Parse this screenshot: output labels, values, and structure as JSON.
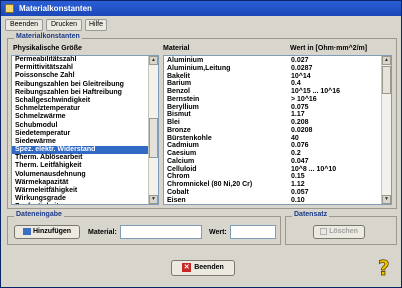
{
  "window": {
    "title": "Materialkonstanten"
  },
  "menu": {
    "items": [
      "Beenden",
      "Drucken",
      "Hilfe"
    ]
  },
  "main_group": {
    "title": "Materialkonstanten"
  },
  "left_list": {
    "header": "Physikalische Größe",
    "selected_index": 14,
    "items": [
      "Permeabilitätszahl",
      "Permittivitätszahl",
      "Poissonsche Zahl",
      "Reibungszahlen bei Gleitreibung",
      "Reibungszahlen bei Haftreibung",
      "Schallgeschwindigkeit",
      "Schmelztemperatur",
      "Schmelzwärme",
      "Schubmodul",
      "Siedetemperatur",
      "Siedewärme",
      "Spez. elektr. Widerstand",
      "Therm. Ablösearbeit",
      "Therm. Leitfähigkeit",
      "Volumenausdehnung",
      "Wärmekapazität",
      "Wärmeleitfähigkeit",
      "Wirkungsgrade",
      "Zugfestigkeit"
    ]
  },
  "right_table": {
    "header_material": "Material",
    "header_value": "Wert in [Ohm·mm^2/m]",
    "rows": [
      [
        "Aluminium",
        "0.027"
      ],
      [
        "Aluminium,Leitung",
        "0.0287"
      ],
      [
        "Bakelit",
        "10^14"
      ],
      [
        "Barium",
        "0.4"
      ],
      [
        "Benzol",
        "10^15 ... 10^16"
      ],
      [
        "Bernstein",
        "> 10^16"
      ],
      [
        "Beryllium",
        "0.075"
      ],
      [
        "Bismut",
        "1.17"
      ],
      [
        "Blei",
        "0.208"
      ],
      [
        "Bronze",
        "0.0208"
      ],
      [
        "Bürstenkohle",
        "40"
      ],
      [
        "Cadmium",
        "0.076"
      ],
      [
        "Caesium",
        "0.2"
      ],
      [
        "Calcium",
        "0.047"
      ],
      [
        "Celluloid",
        "10^8 ... 10^10"
      ],
      [
        "Chrom",
        "0.15"
      ],
      [
        "Chromnickel (80 Ni,20 Cr)",
        "1.12"
      ],
      [
        "Cobalt",
        "0.057"
      ],
      [
        "Eisen",
        "0.10"
      ]
    ]
  },
  "dateneingabe": {
    "title": "Dateneingabe",
    "add_label": "Hinzufügen",
    "material_label": "Material:",
    "value_label": "Wert:",
    "material_value": "",
    "wert_value": ""
  },
  "datensatz": {
    "title": "Datensatz",
    "delete_label": "Löschen"
  },
  "footer": {
    "exit_label": "Beenden"
  },
  "colors": {
    "selection": "#316ac5",
    "titlebar": "#1a47b8"
  }
}
